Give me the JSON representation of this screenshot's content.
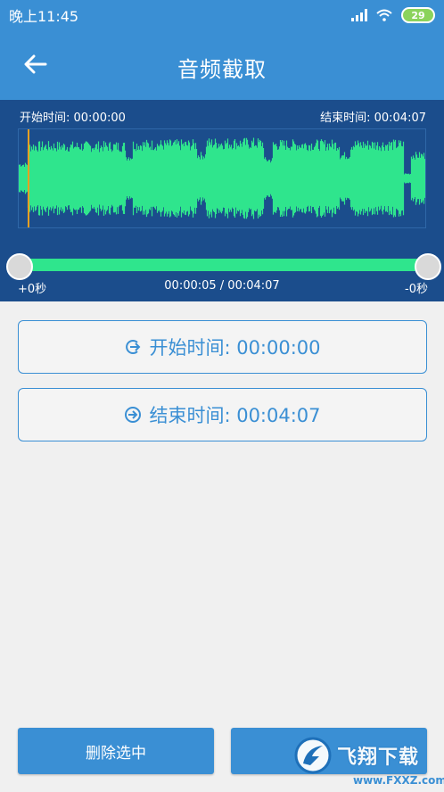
{
  "status_bar": {
    "time": "晚上11:45",
    "battery": "29"
  },
  "header": {
    "title": "音频截取"
  },
  "waveform": {
    "start_label": "开始时间: 00:00:00",
    "end_label": "结束时间: 00:04:07",
    "slider_left_label": "+0秒",
    "position_label": "00:00:05 / 00:04:07",
    "slider_right_label": "-0秒",
    "colors": {
      "background": "#1b4d8c",
      "wave": "#2fe58d",
      "playhead": "#f0a020"
    }
  },
  "buttons": {
    "start_time": "开始时间: 00:00:00",
    "end_time": "结束时间: 00:04:07",
    "delete_selection": "删除选中",
    "second_action": ""
  },
  "watermark": {
    "text": "飞翔下载",
    "url": "www.FXXZ.com"
  },
  "colors": {
    "accent": "#3a8fd4",
    "page_bg": "#f0f0f0"
  }
}
